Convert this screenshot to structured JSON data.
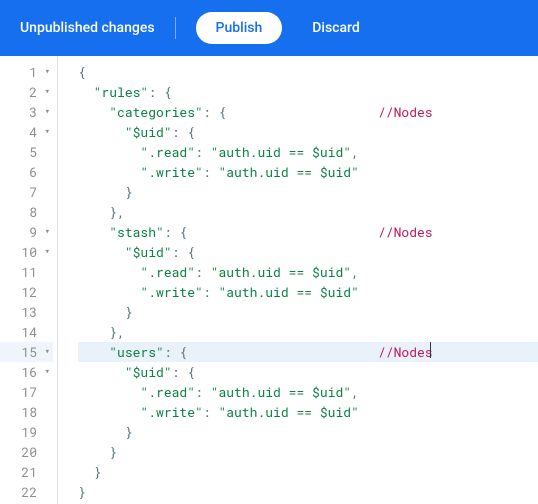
{
  "toolbar": {
    "status_label": "Unpublished changes",
    "publish_label": "Publish",
    "discard_label": "Discard"
  },
  "editor": {
    "active_line": 15,
    "lines": [
      {
        "num": 1,
        "foldable": true,
        "tokens": [
          [
            "punc",
            "{"
          ]
        ]
      },
      {
        "num": 2,
        "foldable": true,
        "tokens": [
          [
            "plain",
            "  "
          ],
          [
            "key",
            "\"rules\""
          ],
          [
            "punc",
            ": {"
          ]
        ]
      },
      {
        "num": 3,
        "foldable": true,
        "tokens": [
          [
            "plain",
            "    "
          ],
          [
            "key",
            "\"categories\""
          ],
          [
            "punc",
            ": {"
          ]
        ],
        "comment": "//Nodes"
      },
      {
        "num": 4,
        "foldable": true,
        "tokens": [
          [
            "plain",
            "      "
          ],
          [
            "key",
            "\"$uid\""
          ],
          [
            "punc",
            ": {"
          ]
        ]
      },
      {
        "num": 5,
        "foldable": false,
        "tokens": [
          [
            "plain",
            "        "
          ],
          [
            "key",
            "\".read\""
          ],
          [
            "punc",
            ": "
          ],
          [
            "str",
            "\"auth.uid == $uid\""
          ],
          [
            "punc",
            ","
          ]
        ]
      },
      {
        "num": 6,
        "foldable": false,
        "tokens": [
          [
            "plain",
            "        "
          ],
          [
            "key",
            "\".write\""
          ],
          [
            "punc",
            ": "
          ],
          [
            "str",
            "\"auth.uid == $uid\""
          ]
        ]
      },
      {
        "num": 7,
        "foldable": false,
        "tokens": [
          [
            "plain",
            "      "
          ],
          [
            "punc",
            "}"
          ]
        ]
      },
      {
        "num": 8,
        "foldable": false,
        "tokens": [
          [
            "plain",
            "    "
          ],
          [
            "punc",
            "},"
          ]
        ]
      },
      {
        "num": 9,
        "foldable": true,
        "tokens": [
          [
            "plain",
            "    "
          ],
          [
            "key",
            "\"stash\""
          ],
          [
            "punc",
            ": {"
          ]
        ],
        "comment": "//Nodes"
      },
      {
        "num": 10,
        "foldable": true,
        "tokens": [
          [
            "plain",
            "      "
          ],
          [
            "key",
            "\"$uid\""
          ],
          [
            "punc",
            ": {"
          ]
        ]
      },
      {
        "num": 11,
        "foldable": false,
        "tokens": [
          [
            "plain",
            "        "
          ],
          [
            "key",
            "\".read\""
          ],
          [
            "punc",
            ": "
          ],
          [
            "str",
            "\"auth.uid == $uid\""
          ],
          [
            "punc",
            ","
          ]
        ]
      },
      {
        "num": 12,
        "foldable": false,
        "tokens": [
          [
            "plain",
            "        "
          ],
          [
            "key",
            "\".write\""
          ],
          [
            "punc",
            ": "
          ],
          [
            "str",
            "\"auth.uid == $uid\""
          ]
        ]
      },
      {
        "num": 13,
        "foldable": false,
        "tokens": [
          [
            "plain",
            "      "
          ],
          [
            "punc",
            "}"
          ]
        ]
      },
      {
        "num": 14,
        "foldable": false,
        "tokens": [
          [
            "plain",
            "    "
          ],
          [
            "punc",
            "},"
          ]
        ]
      },
      {
        "num": 15,
        "foldable": true,
        "tokens": [
          [
            "plain",
            "    "
          ],
          [
            "key",
            "\"users\""
          ],
          [
            "punc",
            ": {"
          ]
        ],
        "comment": "//Nodes",
        "cursor_after_comment": true
      },
      {
        "num": 16,
        "foldable": true,
        "tokens": [
          [
            "plain",
            "      "
          ],
          [
            "key",
            "\"$uid\""
          ],
          [
            "punc",
            ": {"
          ]
        ]
      },
      {
        "num": 17,
        "foldable": false,
        "tokens": [
          [
            "plain",
            "        "
          ],
          [
            "key",
            "\".read\""
          ],
          [
            "punc",
            ": "
          ],
          [
            "str",
            "\"auth.uid == $uid\""
          ],
          [
            "punc",
            ","
          ]
        ]
      },
      {
        "num": 18,
        "foldable": false,
        "tokens": [
          [
            "plain",
            "        "
          ],
          [
            "key",
            "\".write\""
          ],
          [
            "punc",
            ": "
          ],
          [
            "str",
            "\"auth.uid == $uid\""
          ]
        ]
      },
      {
        "num": 19,
        "foldable": false,
        "tokens": [
          [
            "plain",
            "      "
          ],
          [
            "punc",
            "}"
          ]
        ]
      },
      {
        "num": 20,
        "foldable": false,
        "tokens": [
          [
            "plain",
            "    "
          ],
          [
            "punc",
            "}"
          ]
        ]
      },
      {
        "num": 21,
        "foldable": false,
        "tokens": [
          [
            "plain",
            "  "
          ],
          [
            "punc",
            "}"
          ]
        ]
      },
      {
        "num": 22,
        "foldable": false,
        "tokens": [
          [
            "punc",
            "}"
          ]
        ]
      }
    ]
  }
}
